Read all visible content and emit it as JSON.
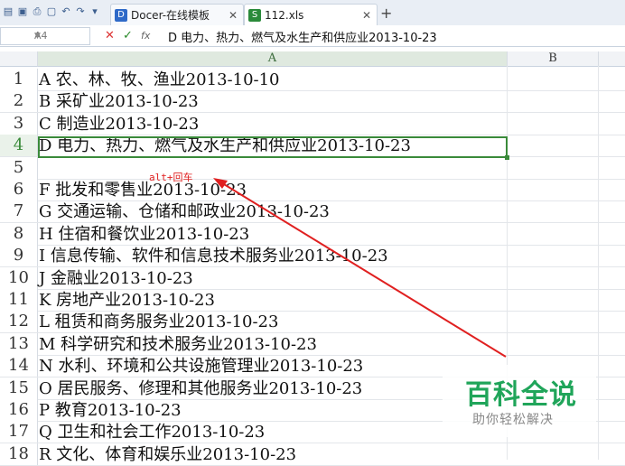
{
  "tabs": [
    {
      "label": "Docer-在线模板",
      "icon": "D"
    },
    {
      "label": "112.xls",
      "icon": "S"
    }
  ],
  "formula_bar": {
    "cell_ref": "A4",
    "content": "D 电力、热力、燃气及水生产和供应业2013-10-23",
    "fx": "fx"
  },
  "columns": [
    "A",
    "B"
  ],
  "rows": [
    {
      "num": "1",
      "text": "A 农、林、牧、渔业2013-10-10"
    },
    {
      "num": "2",
      "text": "B 采矿业2013-10-23"
    },
    {
      "num": "3",
      "text": "C 制造业2013-10-23"
    },
    {
      "num": "4",
      "text": "D 电力、热力、燃气及水生产和供应业2013-10-23"
    },
    {
      "num": "5",
      "text": ""
    },
    {
      "num": "6",
      "text": "F 批发和零售业2013-10-23"
    },
    {
      "num": "7",
      "text": "G 交通运输、仓储和邮政业2013-10-23"
    },
    {
      "num": "8",
      "text": "H 住宿和餐饮业2013-10-23"
    },
    {
      "num": "9",
      "text": "I 信息传输、软件和信息技术服务业2013-10-23"
    },
    {
      "num": "10",
      "text": "J 金融业2013-10-23"
    },
    {
      "num": "11",
      "text": "K 房地产业2013-10-23"
    },
    {
      "num": "12",
      "text": "L 租赁和商务服务业2013-10-23"
    },
    {
      "num": "13",
      "text": "M 科学研究和技术服务业2013-10-23"
    },
    {
      "num": "14",
      "text": "N 水利、环境和公共设施管理业2013-10-23"
    },
    {
      "num": "15",
      "text": "O 居民服务、修理和其他服务业2013-10-23"
    },
    {
      "num": "16",
      "text": "P 教育2013-10-23"
    },
    {
      "num": "17",
      "text": "Q 卫生和社会工作2013-10-23"
    },
    {
      "num": "18",
      "text": "R 文化、体育和娱乐业2013-10-23"
    }
  ],
  "annotation": "alt+回车",
  "watermark": {
    "title": "百科全说",
    "subtitle": "助你轻松解决"
  },
  "colors": {
    "selection": "#3a8a3a",
    "annotation": "#e02020",
    "watermark": "#20a55a"
  }
}
